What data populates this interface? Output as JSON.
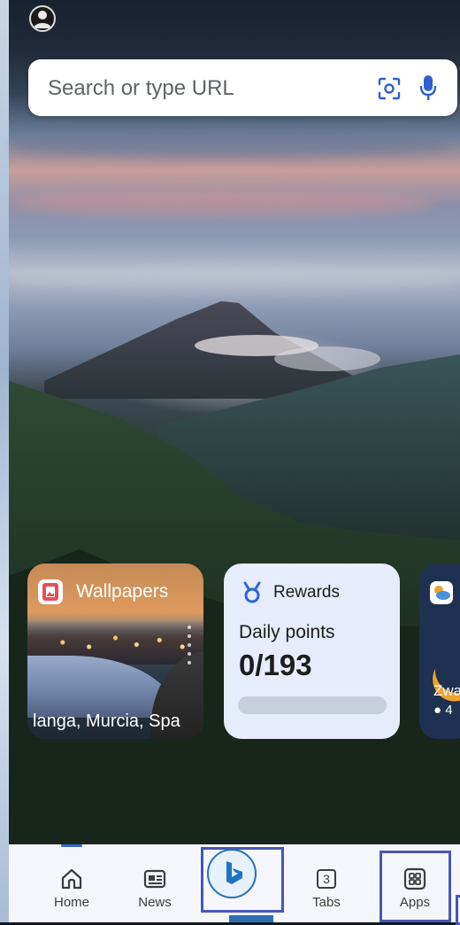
{
  "search": {
    "placeholder": "Search or type URL"
  },
  "cards": {
    "wallpapers": {
      "title": "Wallpapers",
      "location": "langa, Murcia, Spa"
    },
    "rewards": {
      "title": "Rewards",
      "label": "Daily points",
      "value": "0/193",
      "progress": 0
    },
    "weather": {
      "city": "Zwa",
      "rain": "4"
    }
  },
  "nav": {
    "items": [
      {
        "label": "Home",
        "icon": "home-icon"
      },
      {
        "label": "News",
        "icon": "news-icon"
      },
      {
        "label": "",
        "icon": "bing-icon"
      },
      {
        "label": "Tabs",
        "icon": "tabs-icon",
        "count": "3"
      },
      {
        "label": "Apps",
        "icon": "apps-icon"
      }
    ]
  },
  "colors": {
    "accent": "#3b6ddf",
    "highlight": "#4856b8",
    "bing": "#2a6fb8"
  }
}
